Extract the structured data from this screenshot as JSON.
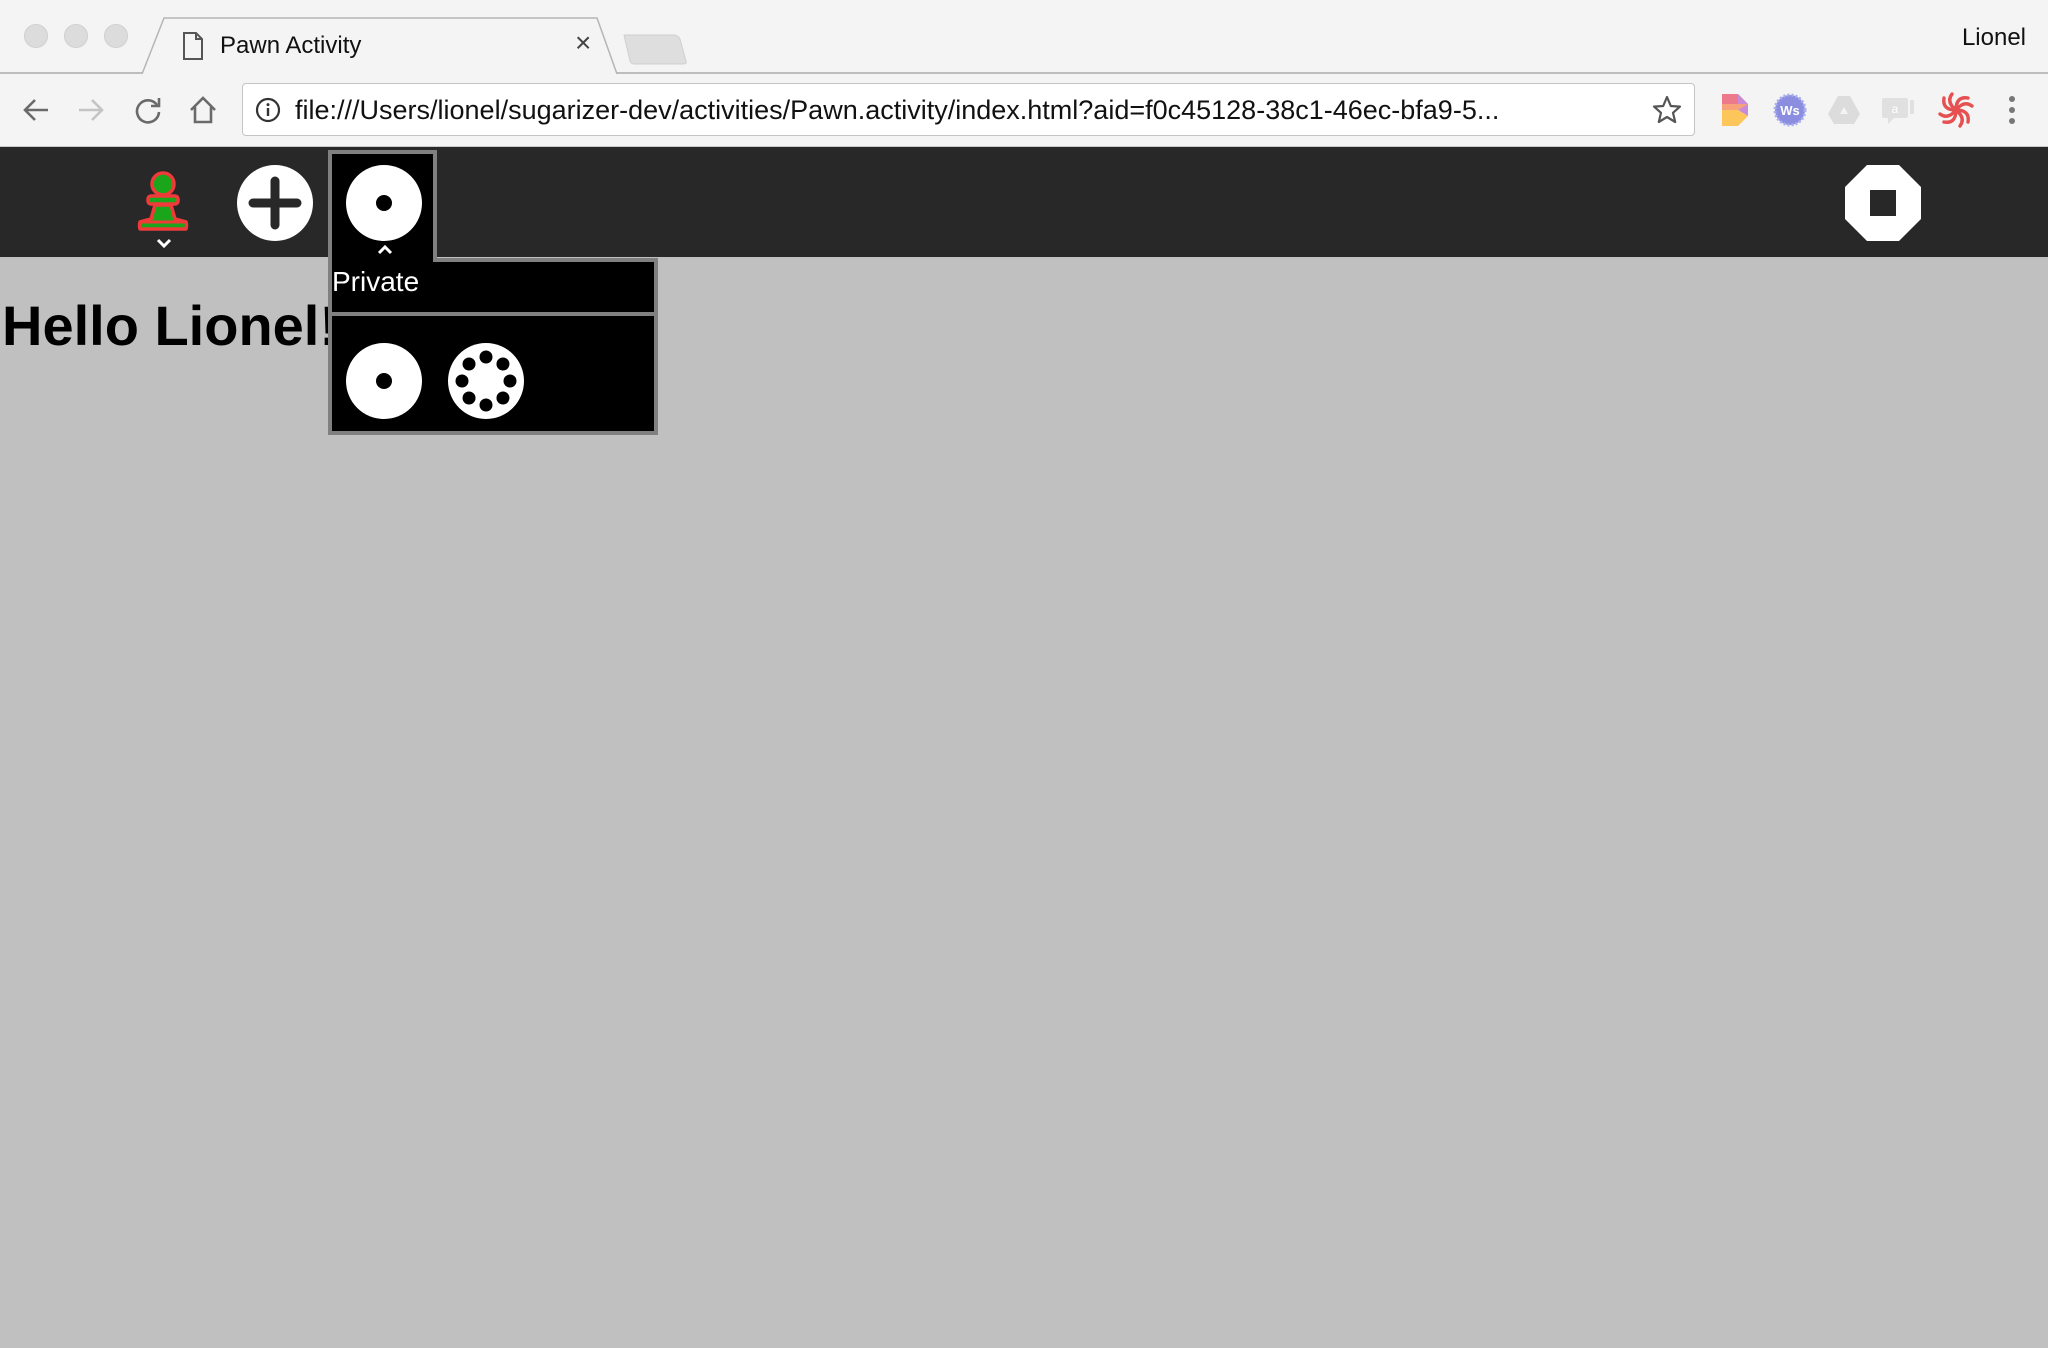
{
  "browser": {
    "tab": {
      "title": "Pawn Activity",
      "close_label": "×"
    },
    "profile_name": "Lionel",
    "address_bar": {
      "url": "file:///Users/lionel/sugarizer-dev/activities/Pawn.activity/index.html?aid=f0c45128-38c1-46ec-bfa9-5..."
    },
    "nav": {
      "back": "back-arrow-icon",
      "forward": "forward-arrow-icon",
      "reload": "reload-icon",
      "home": "home-icon"
    },
    "extensions": [
      "colorful-extension-icon",
      "ws-badge-extension-icon",
      "drive-extension-icon",
      "chat-extension-icon",
      "swirl-extension-icon"
    ],
    "menu_icon": "kebab-menu-icon"
  },
  "toolbar": {
    "activity_icon": "pawn-icon",
    "add_icon": "plus-icon",
    "network_icon": "private-network-icon",
    "stop_icon": "stop-icon",
    "colors": {
      "background": "#282828",
      "pawn_fill": "#1aa51a",
      "pawn_stroke": "#f03a3a"
    }
  },
  "palette": {
    "title": "Private",
    "items": [
      {
        "name": "private",
        "icon": "private-icon"
      },
      {
        "name": "neighborhood",
        "icon": "neighborhood-icon"
      }
    ]
  },
  "content": {
    "greeting": "Hello Lionel!"
  }
}
